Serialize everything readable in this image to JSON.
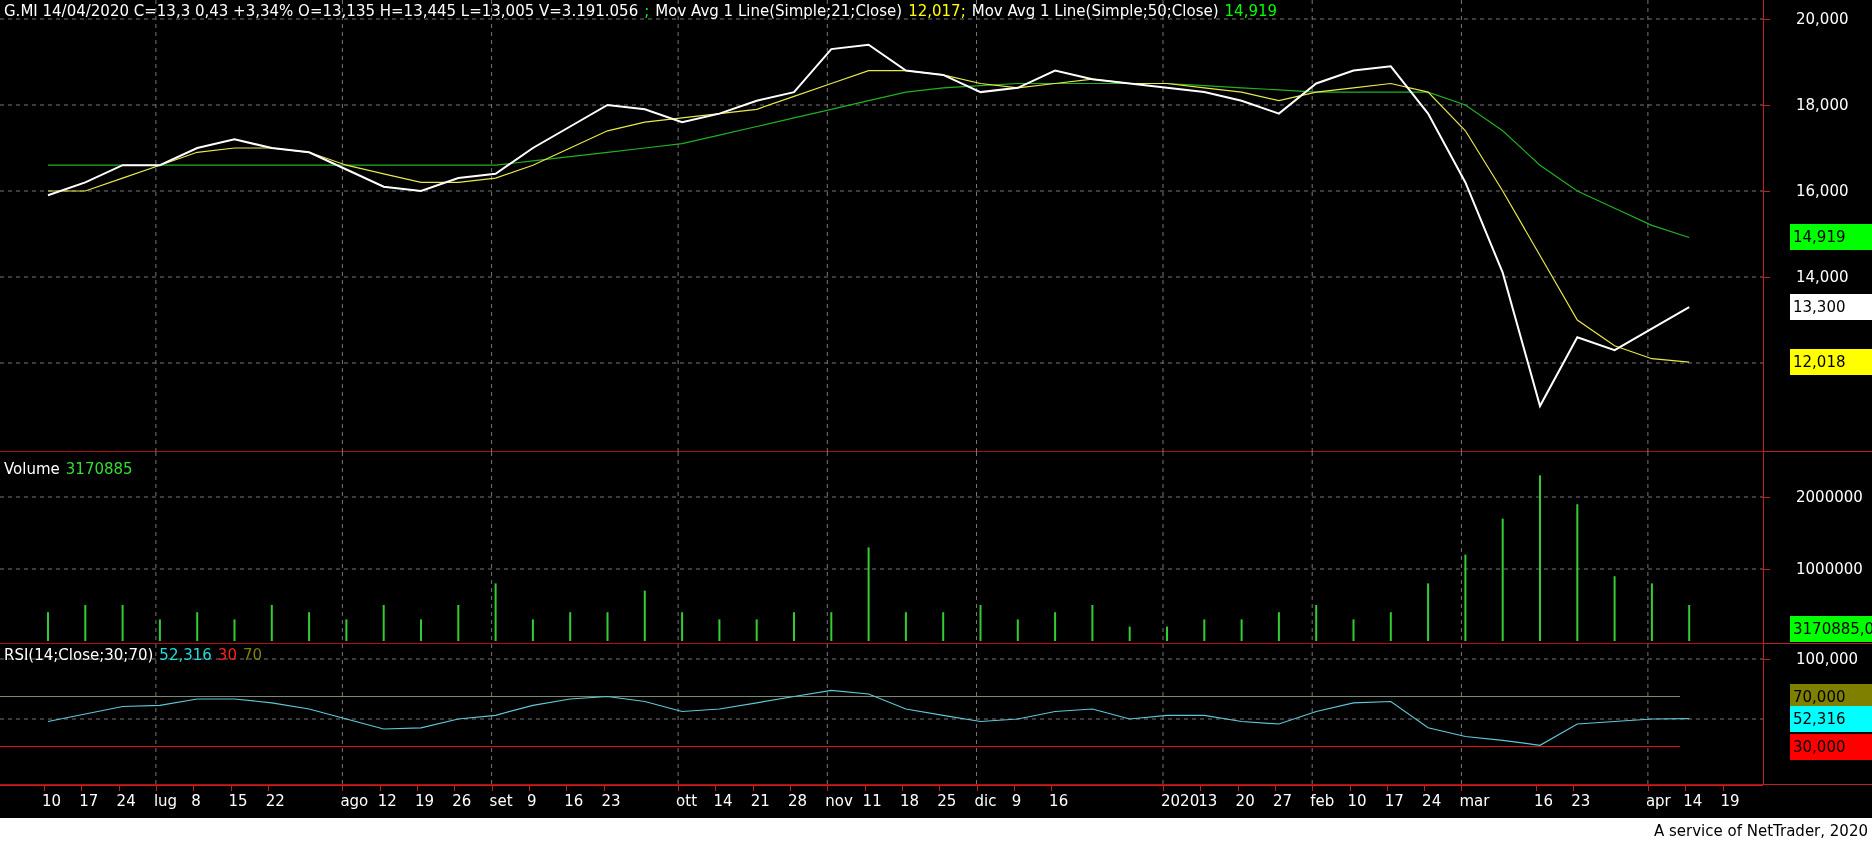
{
  "price_panel": {
    "legend": [
      {
        "text": "G.MI 14/04/2020 C=13,3 0,43 +3,34% O=13,135 H=13,445 L=13,005 V=3.191.056",
        "color": "#ffffff"
      },
      {
        "text": ";",
        "color": "#00ff00"
      },
      {
        "text": "Mov Avg 1 Line(Simple;21;Close)",
        "color": "#ffffff"
      },
      {
        "text": "12,017;",
        "color": "#ffff00"
      },
      {
        "text": "Mov Avg 1 Line(Simple;50;Close)",
        "color": "#ffffff"
      },
      {
        "text": "14,919",
        "color": "#00ff00"
      }
    ],
    "y_labels": [
      "20,000",
      "18,000",
      "16,000",
      "14,000"
    ],
    "badges": [
      {
        "text": "14,919",
        "color": "#00ff00"
      },
      {
        "text": "13,300",
        "color": "#ffffff"
      },
      {
        "text": "12,018",
        "color": "#ffff00"
      }
    ]
  },
  "volume_panel": {
    "legend": [
      {
        "text": "Volume",
        "color": "#ffffff"
      },
      {
        "text": "3170885",
        "color": "#33dd33"
      }
    ],
    "y_labels": [
      "2000000",
      "1000000"
    ],
    "badges": [
      {
        "text": "3170885,0",
        "color": "#00ff00"
      }
    ]
  },
  "rsi_panel": {
    "legend": [
      {
        "text": "RSI(14;Close;30;70)",
        "color": "#ffffff"
      },
      {
        "text": "52,316",
        "color": "#22dddd"
      },
      {
        "text": "30",
        "color": "#ff2020"
      },
      {
        "text": "70",
        "color": "#808000"
      }
    ],
    "y_labels": [
      "100,000"
    ],
    "badges": [
      {
        "text": "70,000",
        "color": "#808000"
      },
      {
        "text": "52,316",
        "color": "#00ffff"
      },
      {
        "text": "30,000",
        "color": "#ff0000"
      }
    ]
  },
  "x_axis": {
    "labels": [
      "10",
      "17",
      "24",
      "lug",
      "8",
      "15",
      "22",
      "ago",
      "12",
      "19",
      "26",
      "set",
      "9",
      "16",
      "23",
      "ott",
      "14",
      "21",
      "28",
      "nov",
      "11",
      "18",
      "25",
      "dic",
      "9",
      "16",
      "2020",
      "13",
      "20",
      "27",
      "feb",
      "10",
      "17",
      "24",
      "mar",
      "16",
      "23",
      "apr",
      "14",
      "19"
    ]
  },
  "footer": {
    "credit": "A service of NetTrader, 2020"
  }
}
